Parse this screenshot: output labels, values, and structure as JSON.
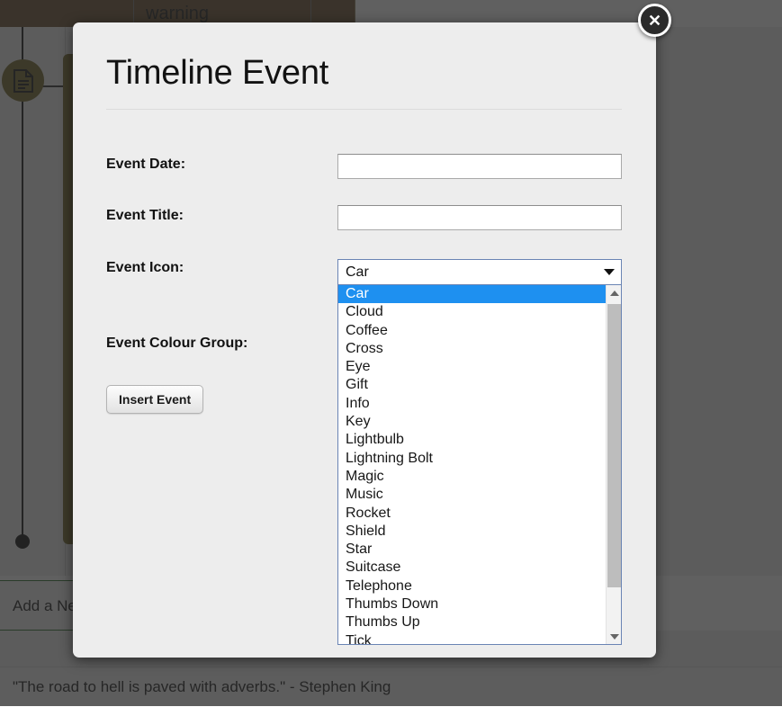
{
  "background": {
    "table_cell_warning": "warning",
    "add_new_row": "Add a New Event",
    "quote": "\"The road to hell is paved with adverbs.\" - Stephen King",
    "event_icon_glyph": "document-icon"
  },
  "modal": {
    "title": "Timeline Event",
    "close_label": "✕",
    "fields": {
      "date_label": "Event Date:",
      "date_value": "",
      "date_placeholder": "",
      "title_label": "Event Title:",
      "title_value": "",
      "title_placeholder": "",
      "icon_label": "Event Icon:",
      "icon_value": "Car",
      "colour_group_label": "Event Colour Group:"
    },
    "submit_label": "Insert Event",
    "icon_options": [
      "Car",
      "Cloud",
      "Coffee",
      "Cross",
      "Eye",
      "Gift",
      "Info",
      "Key",
      "Lightbulb",
      "Lightning Bolt",
      "Magic",
      "Music",
      "Rocket",
      "Shield",
      "Star",
      "Suitcase",
      "Telephone",
      "Thumbs Down",
      "Thumbs Up",
      "Tick"
    ],
    "selected_option_index": 0
  },
  "colors": {
    "modal_bg": "#ededed",
    "overlay": "#555555",
    "highlight": "#1e90f0",
    "accent_olive": "#74692b",
    "topbar_brown": "#6b5434"
  }
}
